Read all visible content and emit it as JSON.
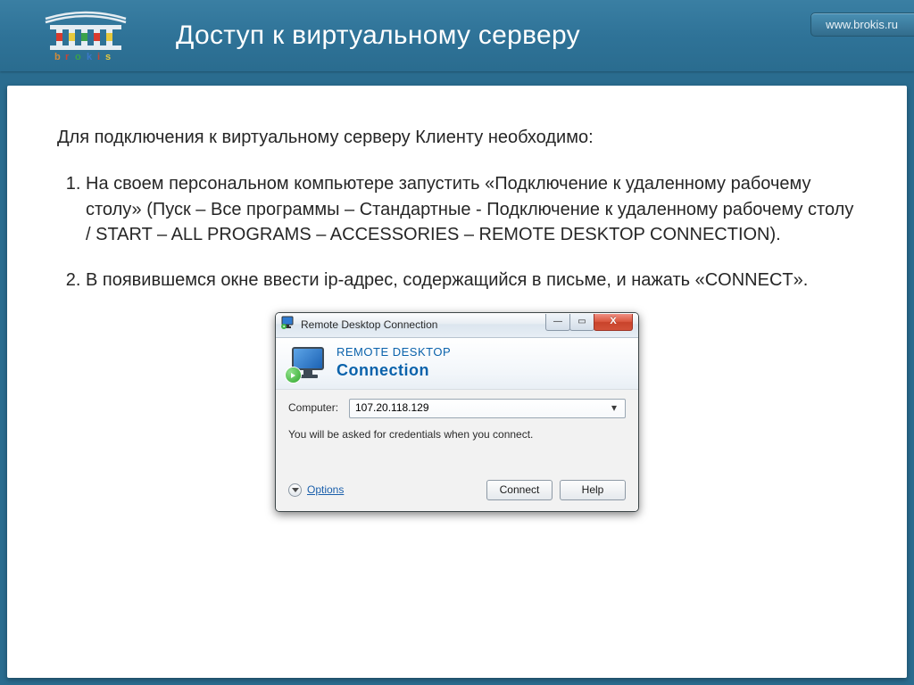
{
  "header": {
    "title": "Доступ к виртуальному серверу",
    "site_link": "www.brokis.ru"
  },
  "body": {
    "intro": "Для подключения к виртуальному серверу Клиенту необходимо:",
    "steps": [
      "На своем персональном компьютере запустить «Подключение к удаленному рабочему столу» (Пуск – Все программы – Стандартные  - Подключение к удаленному рабочему столу / START – ALL PROGRAMS – ACCESSORIES – REMOTE DESKTOP CONNECTION).",
      "В появившемся окне ввести ip-адрес, содержащийся в письме, и нажать «CONNECT»."
    ]
  },
  "rdc": {
    "title": "Remote Desktop Connection",
    "banner_line1": "REMOTE DESKTOP",
    "banner_line2": "Connection",
    "computer_label": "Computer:",
    "computer_value": "107.20.118.129",
    "note": "You will be asked for credentials when you connect.",
    "options": "Options",
    "connect": "Connect",
    "help": "Help",
    "btn_min": "—",
    "btn_max": "▭",
    "btn_close": "X"
  }
}
